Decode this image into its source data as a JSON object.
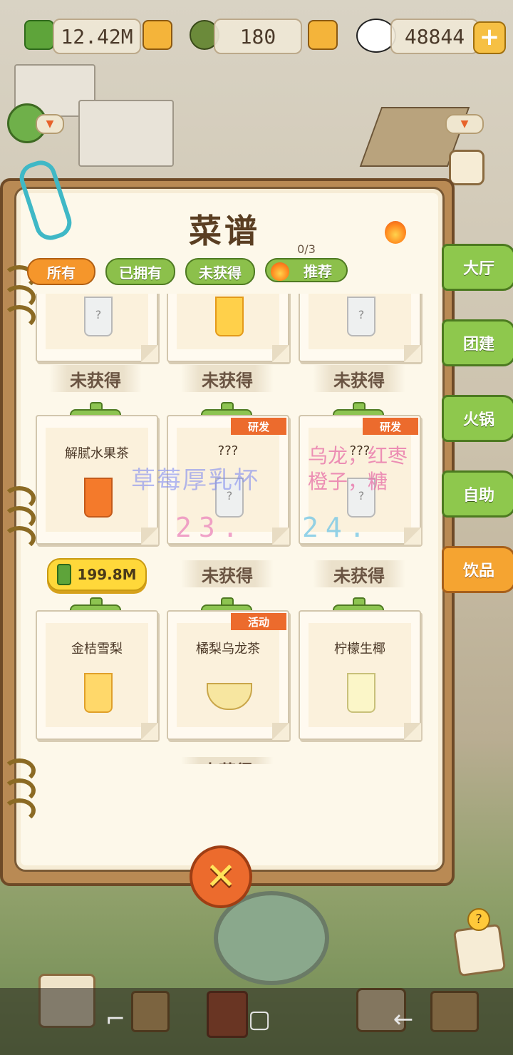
{
  "resources": [
    {
      "name": "bamboo",
      "value": "12.42M"
    },
    {
      "name": "leaf",
      "value": "180"
    },
    {
      "name": "panda",
      "value": "48844"
    }
  ],
  "recipe_book": {
    "title": "菜谱",
    "filters": [
      {
        "label": "所有",
        "active": true
      },
      {
        "label": "已拥有",
        "active": false
      },
      {
        "label": "未获得",
        "active": false
      },
      {
        "label": "推荐",
        "active": false
      }
    ],
    "recommend_counter": "0/3",
    "cards_row1": [
      {
        "name": "",
        "status": "未获得"
      },
      {
        "name": "",
        "status": "未获得"
      },
      {
        "name": "",
        "status": "未获得"
      }
    ],
    "cards_row2": [
      {
        "name": "解腻水果茶",
        "badge": "",
        "price": "199.8M"
      },
      {
        "name": "???",
        "badge": "研发",
        "status": "未获得"
      },
      {
        "name": "???",
        "badge": "研发",
        "status": "未获得"
      }
    ],
    "cards_row3": [
      {
        "name": "金桔雪梨",
        "badge": ""
      },
      {
        "name": "橘梨乌龙茶",
        "badge": "活动"
      },
      {
        "name": "柠檬生椰",
        "badge": ""
      }
    ],
    "next_status_partial": "未获得"
  },
  "side_tabs": [
    "大厅",
    "团建",
    "火锅",
    "自助",
    "饮品"
  ],
  "overlays": {
    "pink_line1": "乌龙，红枣",
    "pink_line2": "橙子，糖",
    "blue_text": "草莓厚乳杯",
    "num_pink": "23.",
    "num_blue": "24."
  },
  "colors": {
    "accent_orange": "#f5962b",
    "tab_green": "#8cc04b",
    "badge_orange": "#ec6b2d"
  }
}
